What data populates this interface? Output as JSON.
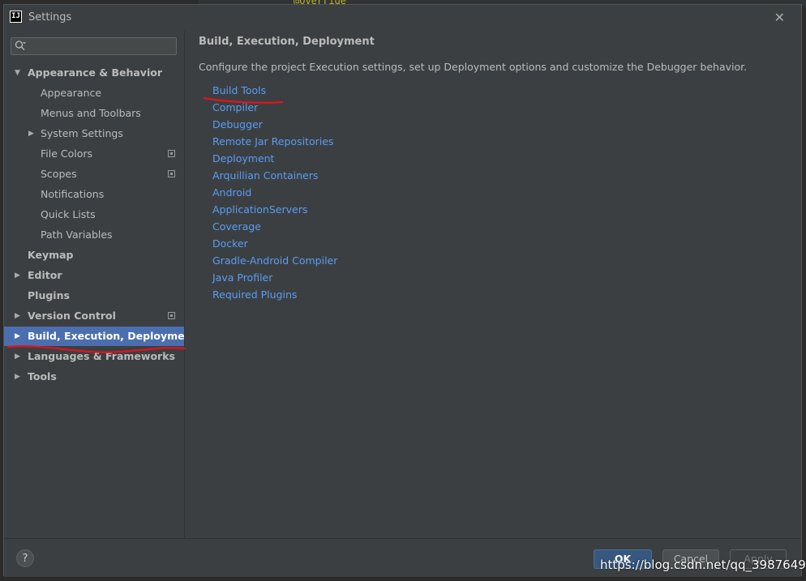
{
  "editor_background": {
    "code_snippet": "@Override"
  },
  "dialog": {
    "title": "Settings",
    "app_icon_text": "IJ",
    "close_glyph": "✕"
  },
  "search": {
    "placeholder": "",
    "value": "",
    "icon": "search-icon"
  },
  "sidebar": {
    "items": [
      {
        "label": "Appearance & Behavior",
        "bold": true,
        "expanded": true
      },
      {
        "label": "Appearance"
      },
      {
        "label": "Menus and Toolbars"
      },
      {
        "label": "System Settings",
        "collapsed": true
      },
      {
        "label": "File Colors",
        "project_icon": true
      },
      {
        "label": "Scopes",
        "project_icon": true
      },
      {
        "label": "Notifications"
      },
      {
        "label": "Quick Lists"
      },
      {
        "label": "Path Variables"
      },
      {
        "label": "Keymap",
        "bold": true
      },
      {
        "label": "Editor",
        "bold": true,
        "collapsed": true
      },
      {
        "label": "Plugins",
        "bold": true
      },
      {
        "label": "Version Control",
        "bold": true,
        "collapsed": true,
        "project_icon": true
      },
      {
        "label": "Build, Execution, Deployment",
        "bold": true,
        "collapsed": true,
        "selected": true
      },
      {
        "label": "Languages & Frameworks",
        "bold": true,
        "collapsed": true
      },
      {
        "label": "Tools",
        "bold": true,
        "collapsed": true
      }
    ]
  },
  "content": {
    "heading": "Build, Execution, Deployment",
    "description": "Configure the project Execution settings, set up Deployment options and customize the Debugger behavior.",
    "links": [
      "Build Tools",
      "Compiler",
      "Debugger",
      "Remote Jar Repositories",
      "Deployment",
      "Arquillian Containers",
      "Android",
      "ApplicationServers",
      "Coverage",
      "Docker",
      "Gradle-Android Compiler",
      "Java Profiler",
      "Required Plugins"
    ]
  },
  "footer": {
    "help_label": "?",
    "ok_label": "OK",
    "cancel_label": "Cancel",
    "apply_label": "Apply"
  },
  "watermark": "https://blog.csdn.net/qq_39876492",
  "colors": {
    "accent_selected": "#4b6eaf",
    "link": "#589df6",
    "annotation_red": "#e0141e"
  }
}
